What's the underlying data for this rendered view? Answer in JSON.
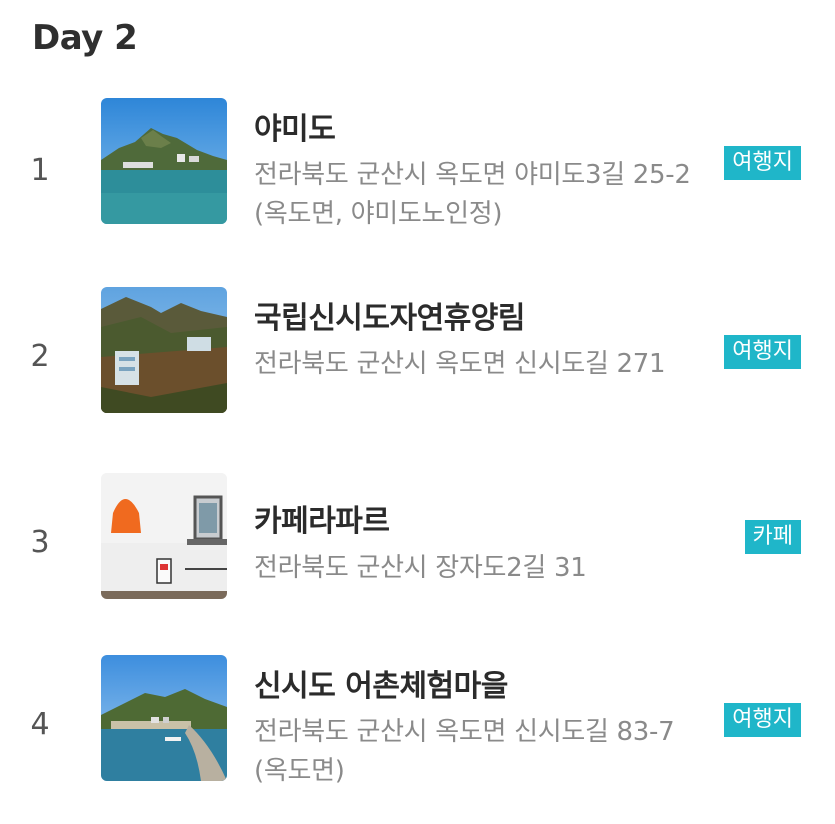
{
  "day_title": "Day 2",
  "items": [
    {
      "number": "1",
      "name": "야미도",
      "address": "전라북도 군산시 옥도면 야미도3길 25-2 (옥도면, 야미도노인정)",
      "category": "여행지",
      "image": "island-harbor-photo"
    },
    {
      "number": "2",
      "name": "국립신시도자연휴양림",
      "address": "전라북도 군산시 옥도면 신시도길 271",
      "category": "여행지",
      "image": "forest-resort-photo"
    },
    {
      "number": "3",
      "name": "카페라파르",
      "address": "전라북도 군산시 장자도2길 31",
      "category": "카페",
      "image": "cafe-wall-photo"
    },
    {
      "number": "4",
      "name": "신시도 어촌체험마을",
      "address": "전라북도 군산시 옥도면 신시도길 83-7 (옥도면)",
      "category": "여행지",
      "image": "fishing-village-photo"
    }
  ],
  "colors": {
    "badge": "#1fb6c9",
    "title": "#2f2f2f",
    "address": "#8a8a8a"
  }
}
